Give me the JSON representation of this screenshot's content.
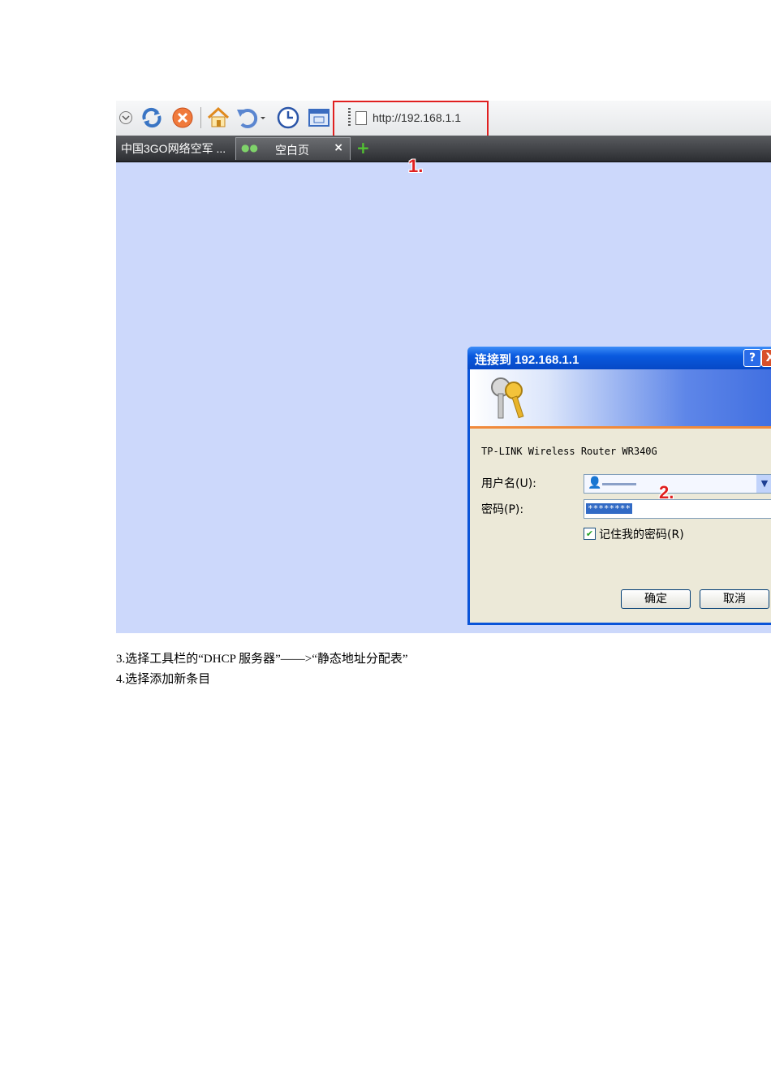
{
  "toolbar": {
    "url": "http://192.168.1.1",
    "icons": [
      "dropdown-icon",
      "refresh-icon",
      "stop-icon",
      "home-icon",
      "undo-icon",
      "history-icon",
      "window-icon",
      "page-icon"
    ]
  },
  "tabs": [
    {
      "label": "中国3GO网络空军 ..."
    },
    {
      "label": "空白页"
    }
  ],
  "annotations": {
    "step1": "1.",
    "step2": "2."
  },
  "dialog": {
    "title": "连接到 192.168.1.1",
    "help_btn": "?",
    "close_btn": "X",
    "device": "TP-LINK Wireless Router WR340G",
    "username_label": "用户名(U):",
    "password_label": "密码(P):",
    "password_value": "********",
    "remember_label": "记住我的密码(R)",
    "remember_checked": true,
    "ok_label": "确定",
    "cancel_label": "取消"
  },
  "caption": {
    "line1": "3.选择工具栏的“DHCP 服务器”——>“静态地址分配表”",
    "line2": "4.选择添加新条目"
  },
  "colors": {
    "annotation_red": "#e02020",
    "desktop_bg": "#ccd8fb",
    "dialog_title": "#0a5adf"
  }
}
